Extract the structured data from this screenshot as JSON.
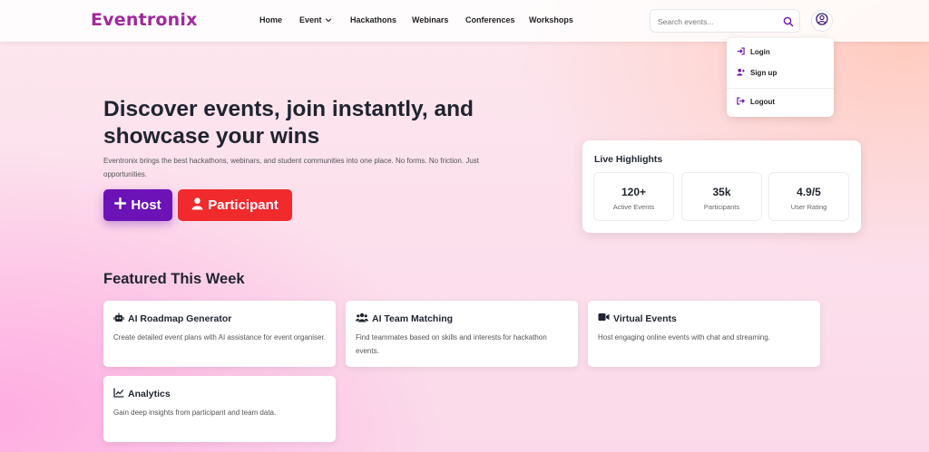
{
  "brand": {
    "name": "Eventronix",
    "color": "#a2279c"
  },
  "nav": {
    "items": [
      {
        "label": "Home"
      },
      {
        "label": "Event",
        "has_dropdown": true
      },
      {
        "label": "Hackathons"
      },
      {
        "label": "Webinars"
      },
      {
        "label": "Conferences"
      },
      {
        "label": "Workshops"
      }
    ]
  },
  "search": {
    "placeholder": "Search events...",
    "value": "",
    "icon": "search-icon"
  },
  "profile_menu": {
    "open": true,
    "items": [
      {
        "label": "Login",
        "icon": "login-icon"
      },
      {
        "label": "Sign up",
        "icon": "user-plus-icon"
      },
      {
        "label": "Logout",
        "icon": "logout-icon"
      }
    ]
  },
  "hero": {
    "title": "Discover events, join instantly, and showcase your wins",
    "description": "Eventronix brings the best hackathons, webinars, and student communities into one place. No forms. No friction. Just opportunities.",
    "buttons": [
      {
        "label": "Host",
        "icon": "plus-icon",
        "color": "#6b13b7"
      },
      {
        "label": "Participant",
        "icon": "user-icon",
        "color": "#f02a2d"
      }
    ]
  },
  "highlights": {
    "title": "Live Highlights",
    "stats": [
      {
        "value": "120+",
        "label": "Active Events"
      },
      {
        "value": "35k",
        "label": "Participants"
      },
      {
        "value": "4.9/5",
        "label": "User Rating"
      }
    ]
  },
  "featured": {
    "title": "Featured This Week",
    "cards": [
      {
        "title": "AI Roadmap Generator",
        "icon": "robot-icon",
        "description": "Create detailed event plans with AI assistance for event organiser."
      },
      {
        "title": "AI Team Matching",
        "icon": "users-icon",
        "description": "Find teammates based on skills and interests for hackathon events."
      },
      {
        "title": "Virtual Events",
        "icon": "video-icon",
        "description": "Host engaging online events with chat and streaming."
      },
      {
        "title": "Analytics",
        "icon": "chart-line-icon",
        "description": "Gain deep insights from participant and team data."
      }
    ]
  }
}
